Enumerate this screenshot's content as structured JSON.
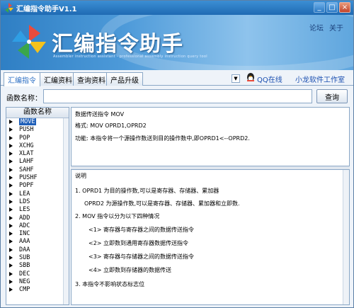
{
  "window": {
    "title": "汇编指令助手V1.1"
  },
  "banner": {
    "title": "汇编指令助手",
    "subtitle": "Assembler instruction assistant - professional assembly instruction query tool",
    "links": [
      "论坛",
      "关于"
    ]
  },
  "tabs": [
    "汇编指令",
    "汇编资料",
    "查询资料",
    "产品升级"
  ],
  "tab_extras": {
    "qq": "QQ在线",
    "studio": "小龙软件工作室"
  },
  "search": {
    "label": "函数名称：",
    "value": "",
    "button": "查询"
  },
  "list": {
    "header": "函数名称",
    "items": [
      "MOVE",
      "PUSH",
      "POP",
      "XCHG",
      "XLAT",
      "LAHF",
      "SAHF",
      "PUSHF",
      "POPF",
      "LEA",
      "LDS",
      "LES",
      "ADD",
      "ADC",
      "INC",
      "AAA",
      "DAA",
      "SUB",
      "SBB",
      "DEC",
      "NEG",
      "CMP"
    ],
    "selected": 0
  },
  "detail": {
    "line1": "数据传送指令 MOV",
    "line2": "格式: MOV OPRD1,OPRD2",
    "line3": "功能: 本指令将一个源操作数送到目的操作数中,即OPRD1<--OPRD2."
  },
  "notes": {
    "heading": "说明",
    "lines": [
      "1. OPRD1 为目的操作数,可以是寄存器、存储器、累加器",
      "OPRD2 为源操作数,可以是寄存器、存储器、累加器和立即数.",
      "2. MOV 指令以分为以下四种情况",
      "<1> 寄存器与寄存器之间的数据传送指令",
      "<2> 立即数到通用寄存器数据传送指令",
      "<3> 寄存器与存储器之间的数据传送指令",
      "<4> 立即数到存储器的数据传送",
      "3. 本指令不影响状态标志位"
    ]
  },
  "colors": {
    "titlebar": "#1f6ab3",
    "selection": "#1f5fb8",
    "link": "#1a4fb0"
  }
}
